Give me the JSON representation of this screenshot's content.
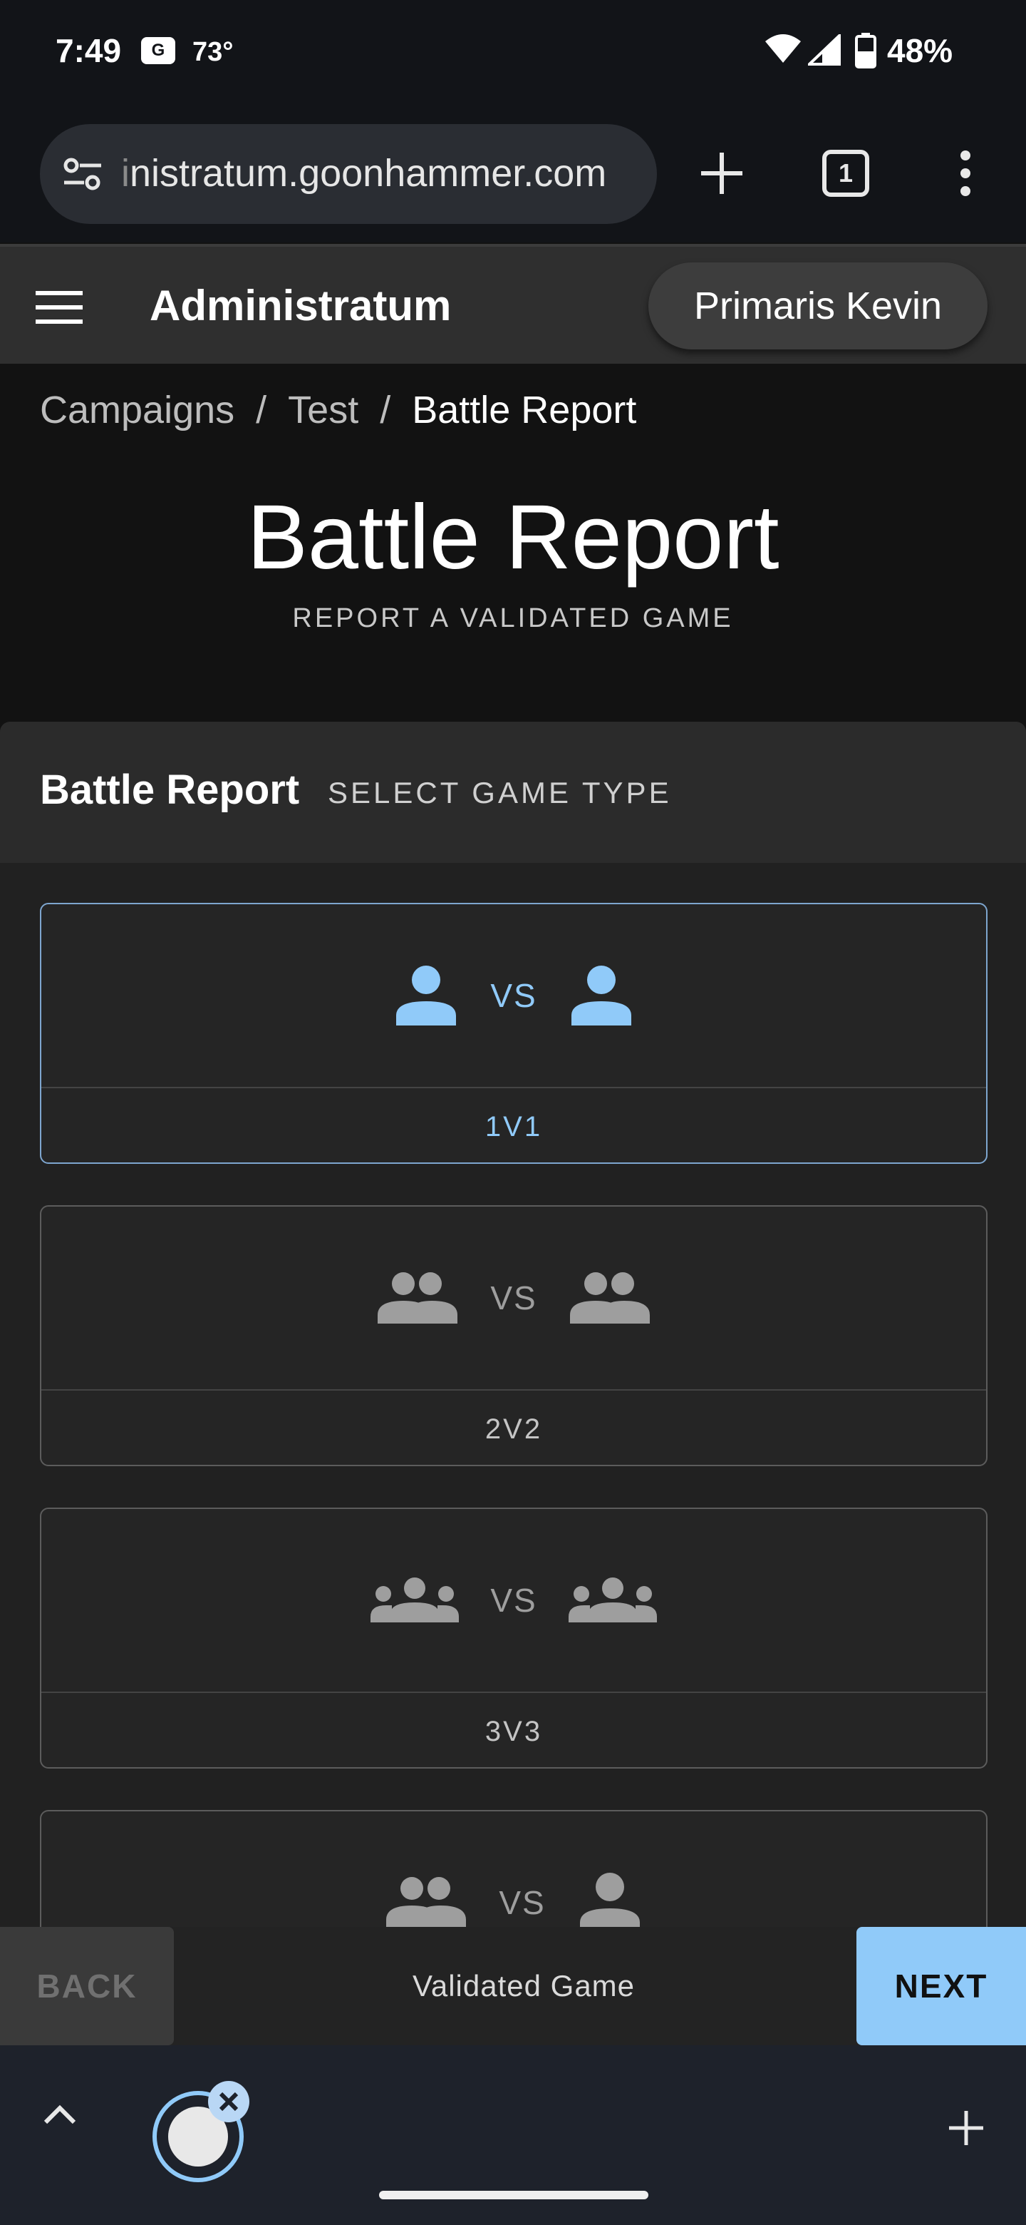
{
  "status_bar": {
    "time": "7:49",
    "badge": "G",
    "temperature": "73°",
    "battery_percent": "48%"
  },
  "browser": {
    "url_faded": "i",
    "url": "nistratum.goonhammer.com",
    "tab_count": "1"
  },
  "app_header": {
    "title": "Administratum",
    "user_name": "Primaris Kevin"
  },
  "breadcrumb": {
    "items": [
      "Campaigns",
      "Test",
      "Battle Report"
    ],
    "separator": "/"
  },
  "page": {
    "title": "Battle Report",
    "subtitle": "REPORT A VALIDATED GAME"
  },
  "card": {
    "title": "Battle Report",
    "subtitle": "SELECT GAME TYPE"
  },
  "game_types": [
    {
      "label": "1V1",
      "vs": "VS",
      "left_icon": "person-icon",
      "right_icon": "person-icon",
      "selected": true
    },
    {
      "label": "2V2",
      "vs": "VS",
      "left_icon": "group-icon",
      "right_icon": "group-icon",
      "selected": false
    },
    {
      "label": "3V3",
      "vs": "VS",
      "left_icon": "groups-icon",
      "right_icon": "groups-icon",
      "selected": false
    },
    {
      "label": "",
      "vs": "VS",
      "left_icon": "group-icon",
      "right_icon": "person-icon",
      "selected": false
    }
  ],
  "actions": {
    "back_label": "BACK",
    "center_label": "Validated Game",
    "next_label": "NEXT"
  },
  "colors": {
    "accent": "#90caf9",
    "selected_border": "#7ea6cf",
    "background": "#121212",
    "header_bg": "#2f2f2f"
  }
}
